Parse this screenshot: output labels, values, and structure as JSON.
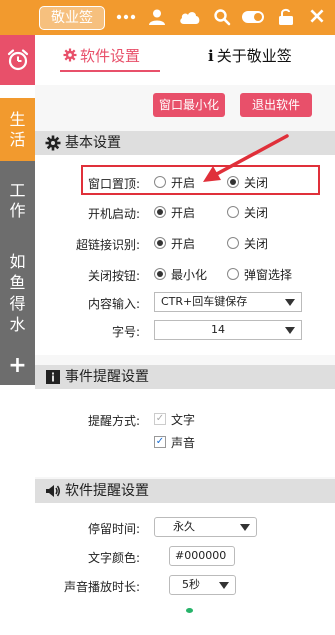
{
  "topbar": {
    "logo_text": "敬业签",
    "icons": [
      "more-dots-icon",
      "user-icon",
      "cloud-icon",
      "search-icon",
      "toggle-icon",
      "lock-icon",
      "close-icon"
    ],
    "close_label": "×"
  },
  "sidebar": {
    "items": [
      {
        "label": "生\n活"
      },
      {
        "label": "工\n作"
      },
      {
        "label": "如\n鱼\n得\n水"
      }
    ],
    "add_label": "+"
  },
  "tabs": {
    "software_settings": "软件设置",
    "about": "关于敬业签",
    "about_prefix": "i"
  },
  "buttons": {
    "minimize": "窗口最小化",
    "exit": "退出软件"
  },
  "basic": {
    "title": "基本设置",
    "pin": {
      "label": "窗口置顶:",
      "on": "开启",
      "off": "关闭",
      "selected": "off"
    },
    "startup": {
      "label": "开机启动:",
      "on": "开启",
      "off": "关闭",
      "selected": "on"
    },
    "hyperlink": {
      "label": "超链接识别:",
      "on": "开启",
      "off": "关闭",
      "selected": "on"
    },
    "close_btn": {
      "label": "关闭按钮:",
      "on": "最小化",
      "off": "弹窗选择",
      "selected": "on"
    },
    "input": {
      "label": "内容输入:",
      "value": "CTR+回车键保存"
    },
    "fontsize": {
      "label": "字号:",
      "value": "14"
    }
  },
  "event": {
    "title": "事件提醒设置",
    "method_label": "提醒方式:",
    "text_option": "文字",
    "sound_option": "声音"
  },
  "soft_reminder": {
    "title": "软件提醒设置",
    "stay_label": "停留时间:",
    "stay_value": "永久",
    "color_label": "文字颜色:",
    "color_value": "#000000",
    "sound_label": "声音播放时长:",
    "sound_value": "5秒"
  },
  "colors": {
    "accent_orange": "#f29a2e",
    "accent_red": "#e8506a",
    "sidebar_gray": "#6d6d6d",
    "highlight_red": "#e0303a"
  }
}
